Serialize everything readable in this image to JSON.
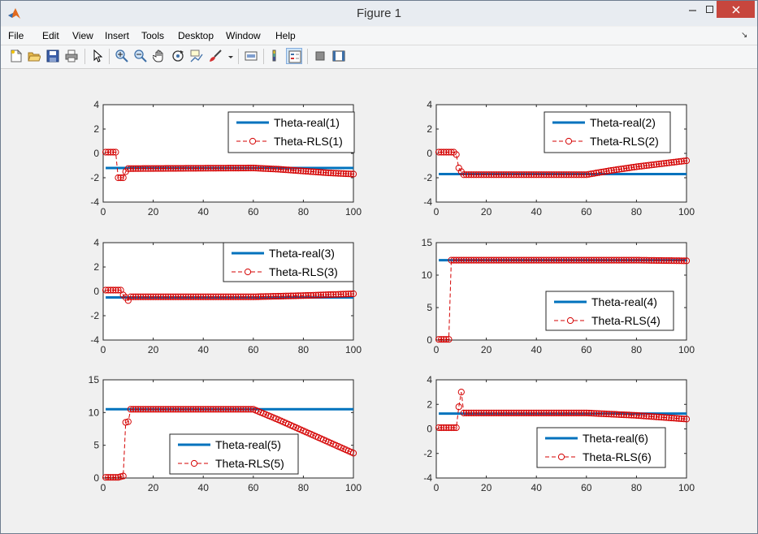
{
  "window": {
    "title": "Figure 1"
  },
  "menu": [
    "File",
    "Edit",
    "View",
    "Insert",
    "Tools",
    "Desktop",
    "Window",
    "Help"
  ],
  "toolbar": [
    "new-figure-icon",
    "open-file-icon",
    "save-icon",
    "print-icon",
    "pointer-icon",
    "zoom-in-icon",
    "zoom-out-icon",
    "pan-icon",
    "rotate-3d-icon",
    "data-cursor-icon",
    "brush-icon",
    "link-plot-icon",
    "colorbar-icon",
    "legend-icon",
    "hide-plot-tools-icon",
    "show-plot-tools-icon"
  ],
  "colors": {
    "real": "#0072bd",
    "rls": "#d40000"
  },
  "chart_data": [
    {
      "type": "line",
      "xlim": [
        0,
        100
      ],
      "ylim": [
        -4,
        4
      ],
      "yticks": [
        -4,
        -2,
        0,
        2,
        4
      ],
      "xticks": [
        0,
        20,
        40,
        60,
        80,
        100
      ],
      "legend_position": "top-right",
      "series": [
        {
          "name": "Theta-real(1)",
          "points": [
            [
              1,
              -1.2
            ],
            [
              100,
              -1.2
            ]
          ]
        },
        {
          "name": "Theta-RLS(1)",
          "points": [
            [
              1,
              0.1
            ],
            [
              2,
              0.1
            ],
            [
              3,
              0.1
            ],
            [
              4,
              0.1
            ],
            [
              5,
              0.1
            ],
            [
              6,
              -2
            ],
            [
              7,
              -2
            ],
            [
              8,
              -2
            ],
            [
              9,
              -1.5
            ],
            [
              10,
              -1.25
            ],
            [
              60,
              -1.2
            ],
            [
              70,
              -1.3
            ],
            [
              80,
              -1.45
            ],
            [
              90,
              -1.6
            ],
            [
              100,
              -1.7
            ]
          ]
        }
      ]
    },
    {
      "type": "line",
      "xlim": [
        0,
        100
      ],
      "ylim": [
        -4,
        4
      ],
      "yticks": [
        -4,
        -2,
        0,
        2,
        4
      ],
      "xticks": [
        0,
        20,
        40,
        60,
        80,
        100
      ],
      "legend_position": "top-right",
      "series": [
        {
          "name": "Theta-real(2)",
          "points": [
            [
              1,
              -1.7
            ],
            [
              100,
              -1.7
            ]
          ]
        },
        {
          "name": "Theta-RLS(2)",
          "points": [
            [
              1,
              0.1
            ],
            [
              2,
              0.1
            ],
            [
              3,
              0.1
            ],
            [
              4,
              0.1
            ],
            [
              5,
              0.1
            ],
            [
              6,
              0.1
            ],
            [
              7,
              0.1
            ],
            [
              8,
              -0.1
            ],
            [
              9,
              -1.2
            ],
            [
              10,
              -1.5
            ],
            [
              11,
              -1.75
            ],
            [
              60,
              -1.75
            ],
            [
              70,
              -1.4
            ],
            [
              80,
              -1.1
            ],
            [
              90,
              -0.85
            ],
            [
              100,
              -0.6
            ]
          ]
        }
      ]
    },
    {
      "type": "line",
      "xlim": [
        0,
        100
      ],
      "ylim": [
        -4,
        4
      ],
      "yticks": [
        -4,
        -2,
        0,
        2,
        4
      ],
      "xticks": [
        0,
        20,
        40,
        60,
        80,
        100
      ],
      "legend_position": "top-right",
      "series": [
        {
          "name": "Theta-real(3)",
          "points": [
            [
              1,
              -0.5
            ],
            [
              100,
              -0.5
            ]
          ]
        },
        {
          "name": "Theta-RLS(3)",
          "points": [
            [
              1,
              0.1
            ],
            [
              2,
              0.1
            ],
            [
              3,
              0.1
            ],
            [
              4,
              0.1
            ],
            [
              5,
              0.1
            ],
            [
              6,
              0.1
            ],
            [
              7,
              0.1
            ],
            [
              8,
              -0.3
            ],
            [
              9,
              -0.5
            ],
            [
              10,
              -0.75
            ],
            [
              11,
              -0.45
            ],
            [
              60,
              -0.45
            ],
            [
              80,
              -0.35
            ],
            [
              100,
              -0.2
            ]
          ]
        }
      ]
    },
    {
      "type": "line",
      "xlim": [
        0,
        100
      ],
      "ylim": [
        0,
        15
      ],
      "yticks": [
        0,
        5,
        10,
        15
      ],
      "xticks": [
        0,
        20,
        40,
        60,
        80,
        100
      ],
      "legend_position": "bottom-right",
      "series": [
        {
          "name": "Theta-real(4)",
          "points": [
            [
              1,
              12.3
            ],
            [
              100,
              12.3
            ]
          ]
        },
        {
          "name": "Theta-RLS(4)",
          "points": [
            [
              1,
              0.1
            ],
            [
              2,
              0.1
            ],
            [
              3,
              0.1
            ],
            [
              4,
              0.1
            ],
            [
              5,
              0.1
            ],
            [
              6,
              12.3
            ],
            [
              60,
              12.3
            ],
            [
              80,
              12.3
            ],
            [
              100,
              12.2
            ]
          ]
        }
      ]
    },
    {
      "type": "line",
      "xlim": [
        0,
        100
      ],
      "ylim": [
        0,
        15
      ],
      "yticks": [
        0,
        5,
        10,
        15
      ],
      "xticks": [
        0,
        20,
        40,
        60,
        80,
        100
      ],
      "legend_position": "bottom-center",
      "series": [
        {
          "name": "Theta-real(5)",
          "points": [
            [
              1,
              10.5
            ],
            [
              100,
              10.5
            ]
          ]
        },
        {
          "name": "Theta-RLS(5)",
          "points": [
            [
              1,
              0.1
            ],
            [
              2,
              0.1
            ],
            [
              3,
              0.1
            ],
            [
              4,
              0.1
            ],
            [
              5,
              0.1
            ],
            [
              6,
              0.1
            ],
            [
              7,
              0.2
            ],
            [
              8,
              0.3
            ],
            [
              9,
              8.5
            ],
            [
              10,
              8.6
            ],
            [
              11,
              10.5
            ],
            [
              60,
              10.5
            ],
            [
              70,
              8.9
            ],
            [
              80,
              7.2
            ],
            [
              90,
              5.5
            ],
            [
              100,
              3.8
            ]
          ]
        }
      ]
    },
    {
      "type": "line",
      "xlim": [
        0,
        100
      ],
      "ylim": [
        -4,
        4
      ],
      "yticks": [
        -4,
        -2,
        0,
        2,
        4
      ],
      "xticks": [
        0,
        20,
        40,
        60,
        80,
        100
      ],
      "legend_position": "bottom-right",
      "series": [
        {
          "name": "Theta-real(6)",
          "points": [
            [
              1,
              1.25
            ],
            [
              100,
              1.25
            ]
          ]
        },
        {
          "name": "Theta-RLS(6)",
          "points": [
            [
              1,
              0.1
            ],
            [
              2,
              0.1
            ],
            [
              3,
              0.1
            ],
            [
              4,
              0.1
            ],
            [
              5,
              0.1
            ],
            [
              6,
              0.1
            ],
            [
              7,
              0.1
            ],
            [
              8,
              0.1
            ],
            [
              9,
              1.8
            ],
            [
              10,
              3
            ],
            [
              11,
              1.3
            ],
            [
              60,
              1.3
            ],
            [
              80,
              1.1
            ],
            [
              100,
              0.8
            ]
          ]
        }
      ]
    }
  ]
}
